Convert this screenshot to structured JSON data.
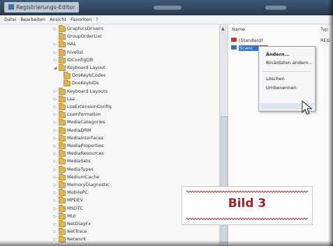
{
  "window": {
    "title": "Registrierungs-Editor"
  },
  "menu": [
    "Datei",
    "Bearbeiten",
    "Ansicht",
    "Favoriten",
    "?"
  ],
  "tree": {
    "items": [
      {
        "label": "GraphicsDrivers",
        "level": 0,
        "state": "collapsed"
      },
      {
        "label": "GroupOrderList",
        "level": 0,
        "state": "none"
      },
      {
        "label": "HAL",
        "level": 0,
        "state": "collapsed"
      },
      {
        "label": "hivelist",
        "level": 0,
        "state": "collapsed"
      },
      {
        "label": "IDConfigDB",
        "level": 0,
        "state": "collapsed"
      },
      {
        "label": "Keyboard Layout",
        "level": 0,
        "state": "expanded"
      },
      {
        "label": "DosKeybCodes",
        "level": 1,
        "state": "none"
      },
      {
        "label": "DosKeybIDs",
        "level": 1,
        "state": "none"
      },
      {
        "label": "Keyboard Layouts",
        "level": 0,
        "state": "collapsed"
      },
      {
        "label": "Lsa",
        "level": 0,
        "state": "collapsed"
      },
      {
        "label": "LsaExtensionConfig",
        "level": 0,
        "state": "collapsed"
      },
      {
        "label": "LsaInformation",
        "level": 0,
        "state": "collapsed"
      },
      {
        "label": "MediaCategories",
        "level": 0,
        "state": "collapsed"
      },
      {
        "label": "MediaDRM",
        "level": 0,
        "state": "collapsed"
      },
      {
        "label": "MediaInterfaces",
        "level": 0,
        "state": "collapsed"
      },
      {
        "label": "MediaProperties",
        "level": 0,
        "state": "collapsed"
      },
      {
        "label": "MediaResources",
        "level": 0,
        "state": "collapsed"
      },
      {
        "label": "MediaSets",
        "level": 0,
        "state": "collapsed"
      },
      {
        "label": "MediaTypes",
        "level": 0,
        "state": "collapsed"
      },
      {
        "label": "MediumCache",
        "level": 0,
        "state": "collapsed"
      },
      {
        "label": "MemoryDiagnostic",
        "level": 0,
        "state": "collapsed"
      },
      {
        "label": "MobilePC",
        "level": 0,
        "state": "collapsed"
      },
      {
        "label": "MPDEV",
        "level": 0,
        "state": "collapsed"
      },
      {
        "label": "MSDTC",
        "level": 0,
        "state": "collapsed"
      },
      {
        "label": "MUI",
        "level": 0,
        "state": "collapsed"
      },
      {
        "label": "NetDiagFx",
        "level": 0,
        "state": "collapsed"
      },
      {
        "label": "NetTrace",
        "level": 0,
        "state": "collapsed"
      },
      {
        "label": "Network",
        "level": 0,
        "state": "collapsed"
      }
    ]
  },
  "values": {
    "headers": {
      "name": "Name",
      "type": "Typ"
    },
    "rows": [
      {
        "name": "(Standard)",
        "type": "REG"
      },
      {
        "name": "Scanc",
        "type": ""
      }
    ]
  },
  "context_menu": {
    "items": [
      "Ändern...",
      "Binärdaten ändern...",
      "Löschen",
      "Umbenennen"
    ],
    "default_item": "Ändern...",
    "hovered_item": "Umbenennen"
  },
  "caption": "Bild 3",
  "colors": {
    "caption": "#a32125",
    "folder": "#dcb45a",
    "selection": "#2f6fd6"
  }
}
